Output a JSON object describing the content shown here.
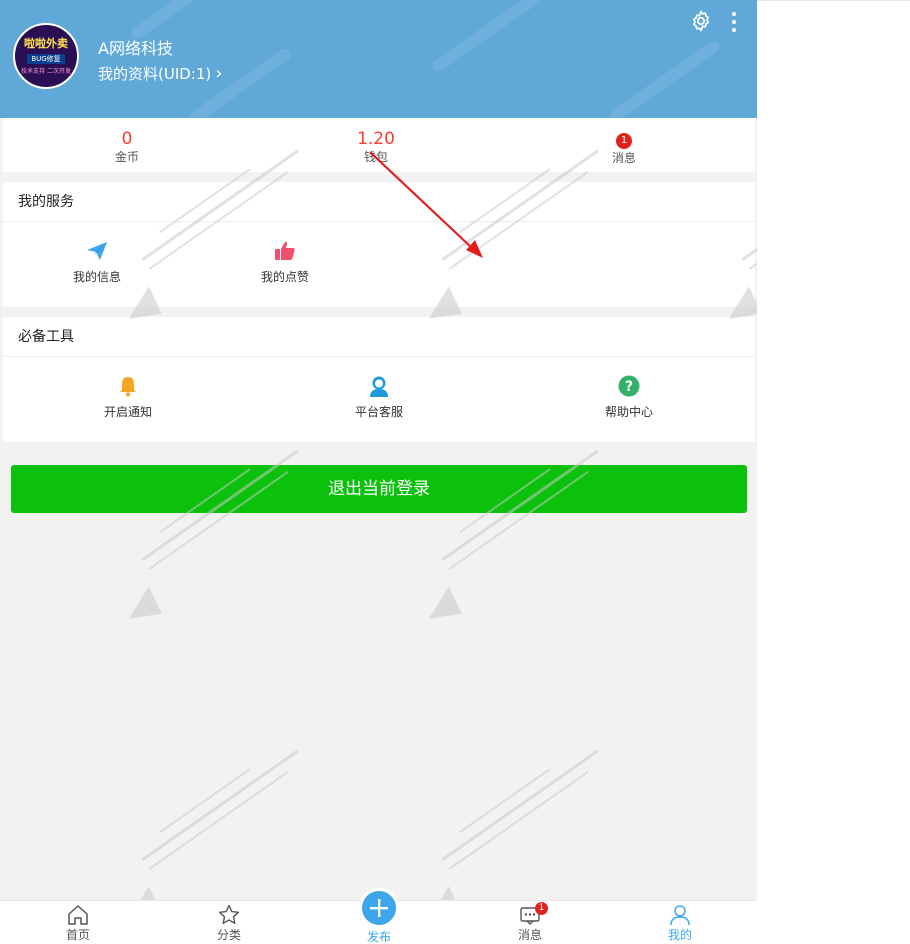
{
  "header": {
    "username": "A网络科技",
    "profile_link": "我的资料(UID:1)",
    "avatar_text": {
      "line1": "啦啦外卖",
      "line2": "BUG修复",
      "line3": "技术支持  二次开发"
    }
  },
  "stats": [
    {
      "value": "0",
      "label": "金币"
    },
    {
      "value": "1.20",
      "label": "钱包"
    },
    {
      "badge": "1",
      "label": "消息"
    }
  ],
  "services": {
    "title": "我的服务",
    "items": [
      {
        "label": "我的信息",
        "icon": "paper-plane-icon"
      },
      {
        "label": "我的点赞",
        "icon": "thumbs-up-icon"
      }
    ]
  },
  "tools": {
    "title": "必备工具",
    "items": [
      {
        "label": "开启通知",
        "icon": "bell-icon"
      },
      {
        "label": "平台客服",
        "icon": "customer-service-icon"
      },
      {
        "label": "帮助中心",
        "icon": "help-icon"
      }
    ]
  },
  "logout_label": "退出当前登录",
  "tabbar": {
    "home": "首页",
    "category": "分类",
    "publish": "发布",
    "messages": "消息",
    "messages_badge": "1",
    "mine": "我的"
  },
  "colors": {
    "header": "#5fa8d8",
    "accent": "#3ea6ea",
    "stat_value": "#ff3b30",
    "logout": "#0bc10b",
    "badge": "#e0211d"
  }
}
